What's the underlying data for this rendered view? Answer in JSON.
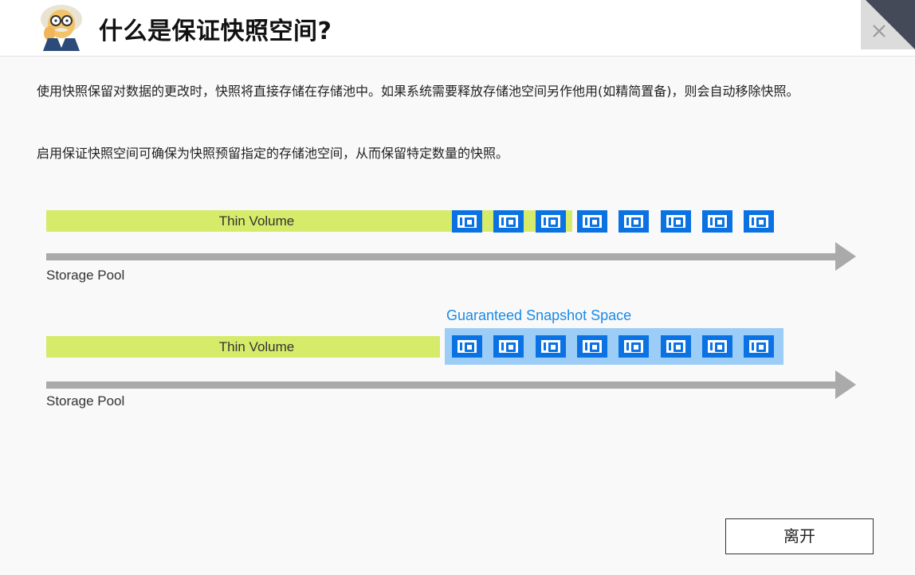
{
  "header": {
    "title": "什么是保证快照空间?",
    "avatar_icon": "professor-avatar-icon",
    "close_icon": "close-icon"
  },
  "body": {
    "paragraph1": "使用快照保留对数据的更改时，快照将直接存储在存储池中。如果系统需要释放存储池空间另作他用(如精简置备)，则会自动移除快照。",
    "paragraph2": "启用保证快照空间可确保为快照预留指定的存储池空间，从而保留特定数量的快照。"
  },
  "diagram": {
    "row1": {
      "volume_label": "Thin Volume",
      "pool_label": "Storage Pool",
      "snapshot_count": 8
    },
    "row2": {
      "volume_label": "Thin Volume",
      "guaranteed_label": "Guaranteed Snapshot Space",
      "pool_label": "Storage Pool",
      "snapshot_count": 8
    },
    "colors": {
      "volume": "#d6eb6a",
      "snapshot": "#0a72e3",
      "guaranteed_space": "#9ccdf7",
      "guaranteed_text": "#1a8ae6",
      "pool_arrow": "#aaaaaa"
    },
    "snapshot_icon": "camera-snapshot-icon"
  },
  "footer": {
    "leave_label": "离开"
  }
}
